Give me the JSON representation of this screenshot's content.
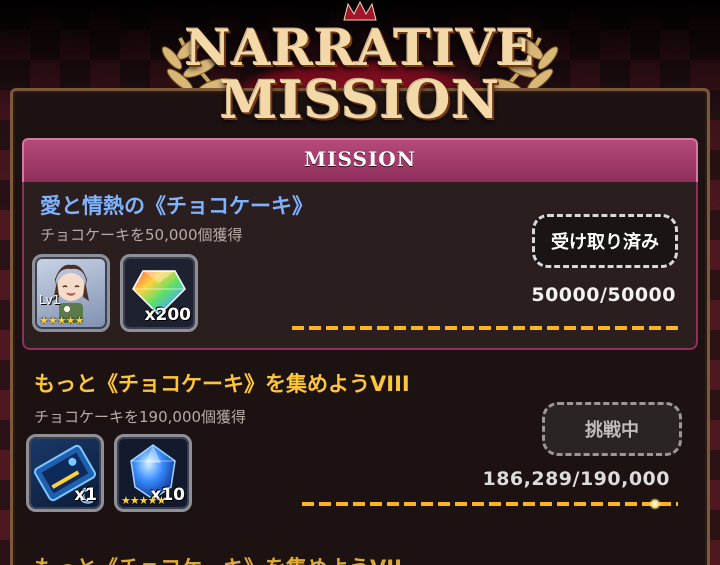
{
  "header": {
    "title_line1": "NARRATIVE",
    "title_line2": "MISSION"
  },
  "tab": {
    "label": "MISSION"
  },
  "missions": [
    {
      "title": "愛と情熱の《チョコケーキ》",
      "description": "チョコケーキを50,000個獲得",
      "status": "受け取り済み",
      "progress_text": "50000/50000",
      "progress": 1.0,
      "rewards": [
        {
          "icon": "character-card-icon",
          "level": "Lv1",
          "stars": "★★★★★"
        },
        {
          "icon": "rainbow-gem-icon",
          "qty": "x200"
        }
      ]
    },
    {
      "title": "もっと《チョコケーキ》を集めようVIII",
      "description": "チョコケーキを190,000個獲得",
      "status": "挑戦中",
      "progress_text": "186,289/190,000",
      "progress": 0.98,
      "rewards": [
        {
          "icon": "blue-ticket-icon",
          "qty": "x1"
        },
        {
          "icon": "blue-crystal-icon",
          "qty": "x10",
          "stars": "★★★★★"
        }
      ]
    }
  ],
  "next_peek": "もっと《チョコケーキ》を集めようVII",
  "colors": {
    "done_title": "#7fb2ff",
    "active_title": "#ffc53a",
    "tab_bg": "#b54a7a",
    "bar": "#ffb320"
  }
}
